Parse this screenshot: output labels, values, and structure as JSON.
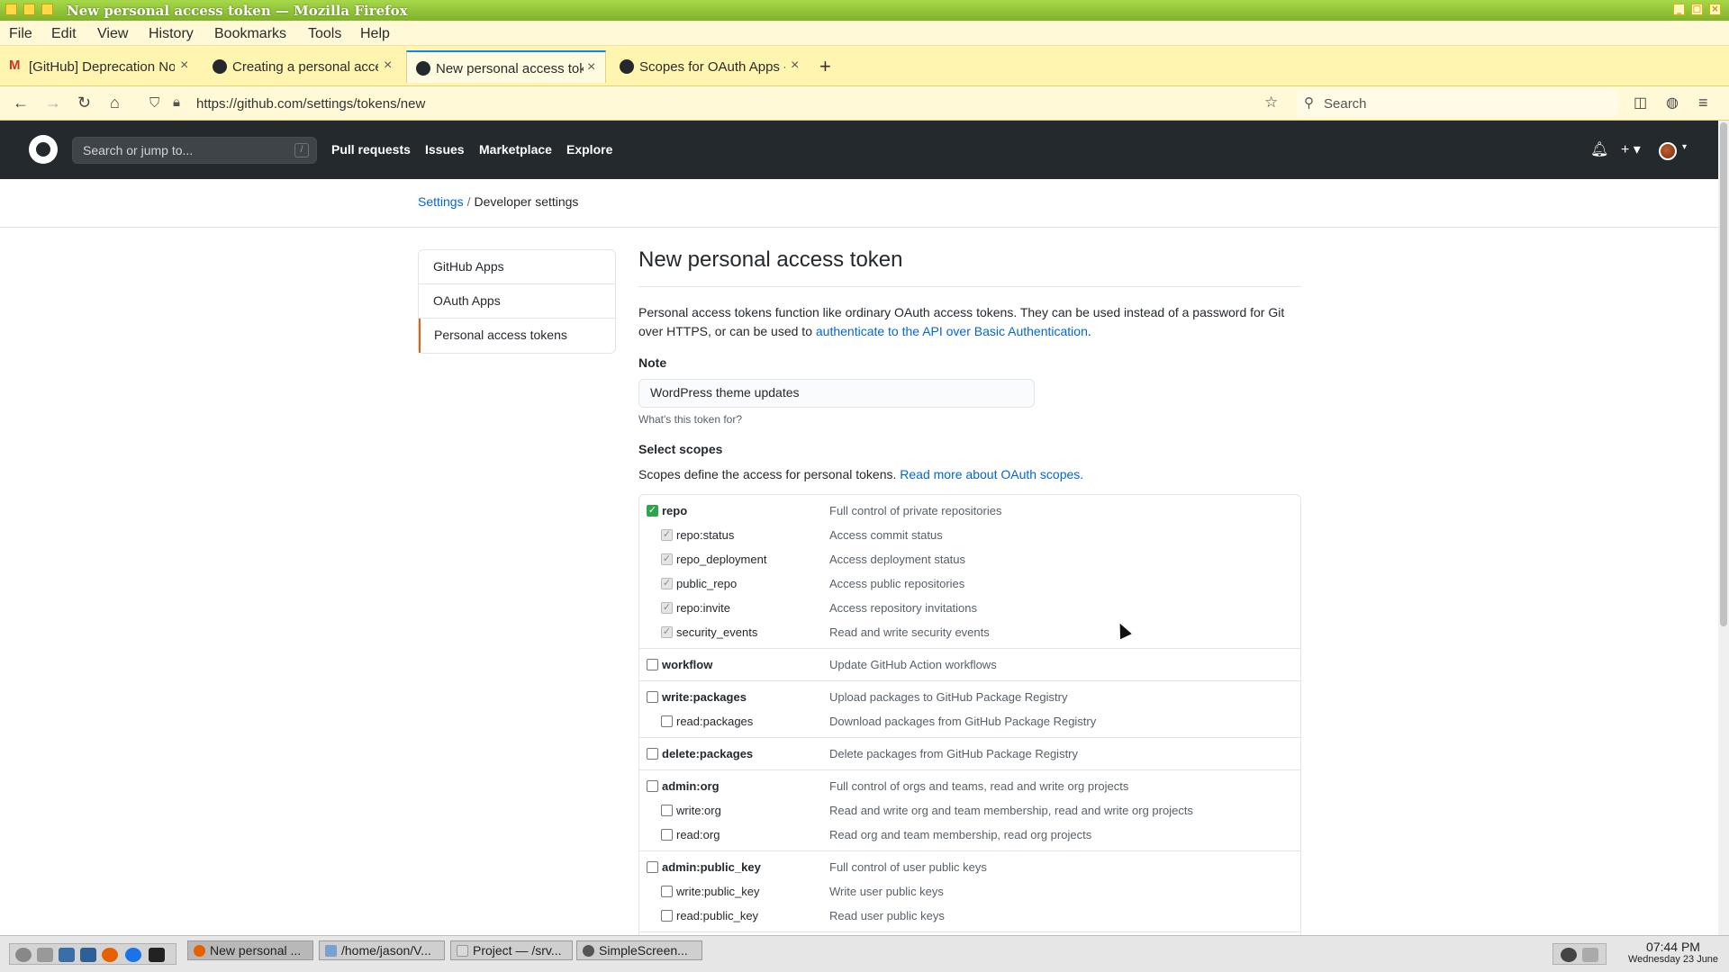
{
  "window": {
    "title": "New personal access token — Mozilla Firefox"
  },
  "menubar": {
    "items": [
      "File",
      "Edit",
      "View",
      "History",
      "Bookmarks",
      "Tools",
      "Help"
    ]
  },
  "tabs": [
    {
      "label": "[GitHub] Deprecation Not",
      "icon": "gmail-icon"
    },
    {
      "label": "Creating a personal acces",
      "icon": "github-icon"
    },
    {
      "label": "New personal access toke",
      "icon": "github-icon",
      "active": true
    },
    {
      "label": "Scopes for OAuth Apps - G",
      "icon": "github-icon"
    }
  ],
  "navbar": {
    "url": "https://github.com/settings/tokens/new",
    "search_placeholder": "Search"
  },
  "github_header": {
    "search_placeholder": "Search or jump to...",
    "search_shortcut": "/",
    "nav": [
      "Pull requests",
      "Issues",
      "Marketplace",
      "Explore"
    ],
    "plus_label": "+ ▾"
  },
  "breadcrumb": {
    "settings": "Settings",
    "separator": "/",
    "current": "Developer settings"
  },
  "sidebar": {
    "items": [
      "GitHub Apps",
      "OAuth Apps",
      "Personal access tokens"
    ],
    "selected": 2
  },
  "main": {
    "title": "New personal access token",
    "intro_text": "Personal access tokens function like ordinary OAuth access tokens. They can be used instead of a password for Git over HTTPS, or can be used to ",
    "intro_link": "authenticate to the API over Basic Authentication",
    "intro_end": ".",
    "note_label": "Note",
    "note_value": "WordPress theme updates",
    "note_hint": "What's this token for?",
    "scopes_label": "Select scopes",
    "scopes_desc": "Scopes define the access for personal tokens. ",
    "scopes_link": "Read more about OAuth scopes."
  },
  "scopes": [
    {
      "name": "repo",
      "desc": "Full control of private repositories",
      "checked": true,
      "children": [
        {
          "name": "repo:status",
          "desc": "Access commit status"
        },
        {
          "name": "repo_deployment",
          "desc": "Access deployment status"
        },
        {
          "name": "public_repo",
          "desc": "Access public repositories"
        },
        {
          "name": "repo:invite",
          "desc": "Access repository invitations"
        },
        {
          "name": "security_events",
          "desc": "Read and write security events"
        }
      ]
    },
    {
      "name": "workflow",
      "desc": "Update GitHub Action workflows",
      "checked": false,
      "children": []
    },
    {
      "name": "write:packages",
      "desc": "Upload packages to GitHub Package Registry",
      "checked": false,
      "children": [
        {
          "name": "read:packages",
          "desc": "Download packages from GitHub Package Registry"
        }
      ]
    },
    {
      "name": "delete:packages",
      "desc": "Delete packages from GitHub Package Registry",
      "checked": false,
      "children": []
    },
    {
      "name": "admin:org",
      "desc": "Full control of orgs and teams, read and write org projects",
      "checked": false,
      "children": [
        {
          "name": "write:org",
          "desc": "Read and write org and team membership, read and write org projects"
        },
        {
          "name": "read:org",
          "desc": "Read org and team membership, read org projects"
        }
      ]
    },
    {
      "name": "admin:public_key",
      "desc": "Full control of user public keys",
      "checked": false,
      "children": [
        {
          "name": "write:public_key",
          "desc": "Write user public keys"
        },
        {
          "name": "read:public_key",
          "desc": "Read user public keys"
        }
      ]
    }
  ],
  "taskbar": {
    "tasks": [
      "New personal ...",
      "/home/jason/V...",
      "Project — /srv...",
      "SimpleScreen..."
    ],
    "time": "07:44 PM",
    "date": "Wednesday 23 June"
  },
  "colors": {
    "accent": "#0366d6",
    "header_bg": "#24292e",
    "check_green": "#2ea44f",
    "selected_marker": "#e36209"
  }
}
